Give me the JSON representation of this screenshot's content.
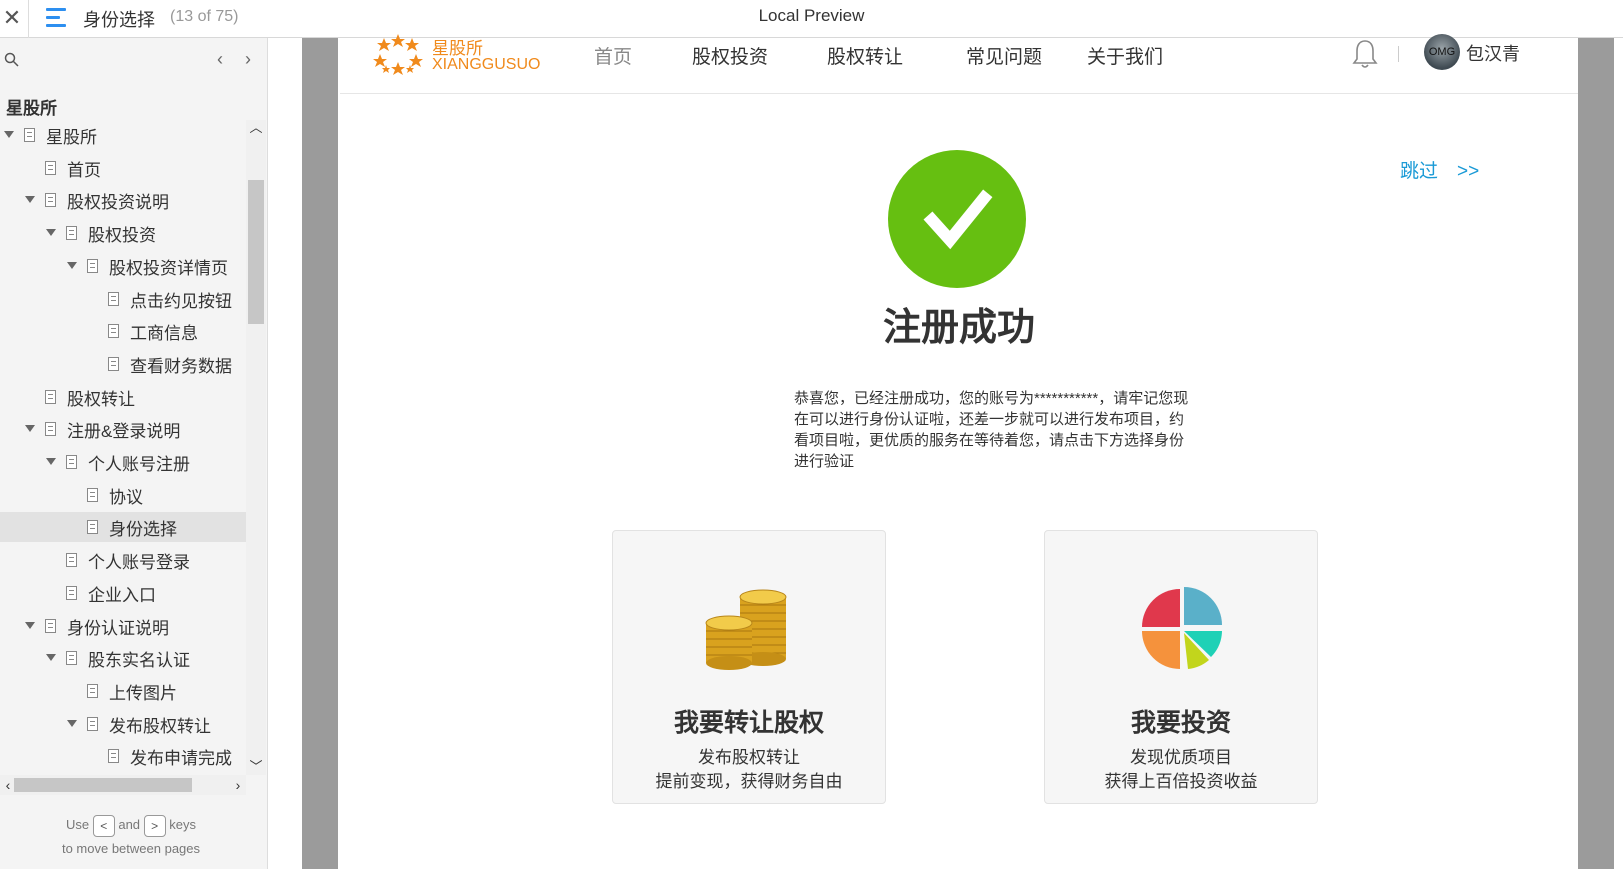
{
  "topbar": {
    "close_glyph": "✕",
    "title": "身份选择",
    "page_count": "(13 of 75)",
    "preview_title": "Local Preview"
  },
  "sidebar": {
    "prev_glyph": "‹",
    "next_glyph": "›",
    "root_title": "星股所",
    "items": [
      {
        "label": "星股所",
        "depth": 0,
        "expandable": true,
        "selected": false
      },
      {
        "label": "首页",
        "depth": 1,
        "expandable": false,
        "selected": false
      },
      {
        "label": "股权投资说明",
        "depth": 1,
        "expandable": true,
        "selected": false
      },
      {
        "label": "股权投资",
        "depth": 2,
        "expandable": true,
        "selected": false
      },
      {
        "label": "股权投资详情页",
        "depth": 3,
        "expandable": true,
        "selected": false
      },
      {
        "label": "点击约见按钮",
        "depth": 4,
        "expandable": false,
        "selected": false
      },
      {
        "label": "工商信息",
        "depth": 4,
        "expandable": false,
        "selected": false
      },
      {
        "label": "查看财务数据",
        "depth": 4,
        "expandable": false,
        "selected": false
      },
      {
        "label": "股权转让",
        "depth": 1,
        "expandable": false,
        "selected": false
      },
      {
        "label": "注册&登录说明",
        "depth": 1,
        "expandable": true,
        "selected": false
      },
      {
        "label": "个人账号注册",
        "depth": 2,
        "expandable": true,
        "selected": false
      },
      {
        "label": "协议",
        "depth": 3,
        "expandable": false,
        "selected": false
      },
      {
        "label": "身份选择",
        "depth": 3,
        "expandable": false,
        "selected": true
      },
      {
        "label": "个人账号登录",
        "depth": 2,
        "expandable": false,
        "selected": false
      },
      {
        "label": "企业入口",
        "depth": 2,
        "expandable": false,
        "selected": false
      },
      {
        "label": "身份认证说明",
        "depth": 1,
        "expandable": true,
        "selected": false
      },
      {
        "label": "股东实名认证",
        "depth": 2,
        "expandable": true,
        "selected": false
      },
      {
        "label": "上传图片",
        "depth": 3,
        "expandable": false,
        "selected": false
      },
      {
        "label": "发布股权转让",
        "depth": 3,
        "expandable": true,
        "selected": false
      },
      {
        "label": "发布申请完成",
        "depth": 4,
        "expandable": false,
        "selected": false
      }
    ],
    "hint_use": "Use",
    "hint_key_left": "<",
    "hint_and": "and",
    "hint_key_right": ">",
    "hint_keys": "keys",
    "hint_line2": "to move between pages"
  },
  "site": {
    "logo_cn": "星股所",
    "logo_en": "XIANGGUSUO",
    "nav": [
      "首页",
      "股权投资",
      "股权转让",
      "常见问题",
      "关于我们"
    ],
    "avatar_text": "OMG",
    "username": "包汉青",
    "skip": "跳过　>>",
    "success_title": "注册成功",
    "message": "恭喜您，已经注册成功，您的账号为***********，请牢记您现在可以进行身份认证啦，还差一步就可以进行发布项目，约看项目啦，更优质的服务在等待着您，请点击下方选择身份进行验证",
    "cards": [
      {
        "title": "我要转让股权",
        "line1": "发布股权转让",
        "line2": "提前变现，获得财务自由",
        "icon": "gold-coins-icon"
      },
      {
        "title": "我要投资",
        "line1": "发现优质项目",
        "line2": "获得上百倍投资收益",
        "icon": "pie-chart-icon"
      }
    ]
  },
  "colors": {
    "accent_blue": "#2d8ff0",
    "logo_orange": "#f08a1c",
    "success_green": "#66bf11",
    "skip_blue": "#1a9ad6"
  }
}
